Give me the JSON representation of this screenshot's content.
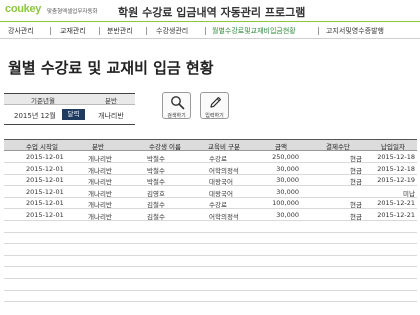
{
  "header": {
    "logo": "coukey",
    "logo_sub": "맞춤형엑셀업무자동화",
    "title": "학원 수강료 입금내역 자동관리 프로그램"
  },
  "menu": [
    {
      "label": "강사관리"
    },
    {
      "label": "교재관리"
    },
    {
      "label": "분반관리"
    },
    {
      "label": "수강생관리"
    },
    {
      "label": "월별수강료및교재비입금현황"
    },
    {
      "label": "고지서및영수증발행"
    }
  ],
  "page_title": "월별 수강료 및 교재비 입금 현황",
  "filter": {
    "head_month": "기준년월",
    "head_class": "분반",
    "year_month": "2015년 12월",
    "month_button": "달력",
    "class_value": "개나리반"
  },
  "buttons": {
    "search": "검색하기",
    "input": "입력하기"
  },
  "table": {
    "columns": [
      "수업 시작일",
      "분반",
      "수강생 이름",
      "교육비 구분",
      "금액",
      "결제수단",
      "납입일자"
    ],
    "rows": [
      [
        "2015-12-01",
        "개나리반",
        "박철수",
        "수강료",
        "250,000",
        "현금",
        "2015-12-18"
      ],
      [
        "2015-12-01",
        "개나리반",
        "박철수",
        "어학의정석",
        "30,000",
        "현금",
        "2015-12-18"
      ],
      [
        "2015-12-01",
        "개나리반",
        "박철수",
        "대왕국어",
        "30,000",
        "현금",
        "2015-12-19"
      ],
      [
        "2015-12-01",
        "개나리반",
        "김영호",
        "대왕국어",
        "30,000",
        "",
        "미납"
      ],
      [
        "2015-12-01",
        "개나리반",
        "김철수",
        "수강료",
        "100,000",
        "현금",
        "2015-12-21"
      ],
      [
        "2015-12-01",
        "개나리반",
        "김철수",
        "어학의정석",
        "30,000",
        "현금",
        "2015-12-21"
      ]
    ],
    "empty_rows": 7
  },
  "colors": {
    "brand_green": "#8dc63f",
    "active_menu": "#2e8b3a",
    "month_button_bg": "#1f3a5f",
    "header_bg": "#dcdcdc"
  },
  "icons": {
    "search": "magnifier-icon",
    "input": "pencil-icon"
  }
}
